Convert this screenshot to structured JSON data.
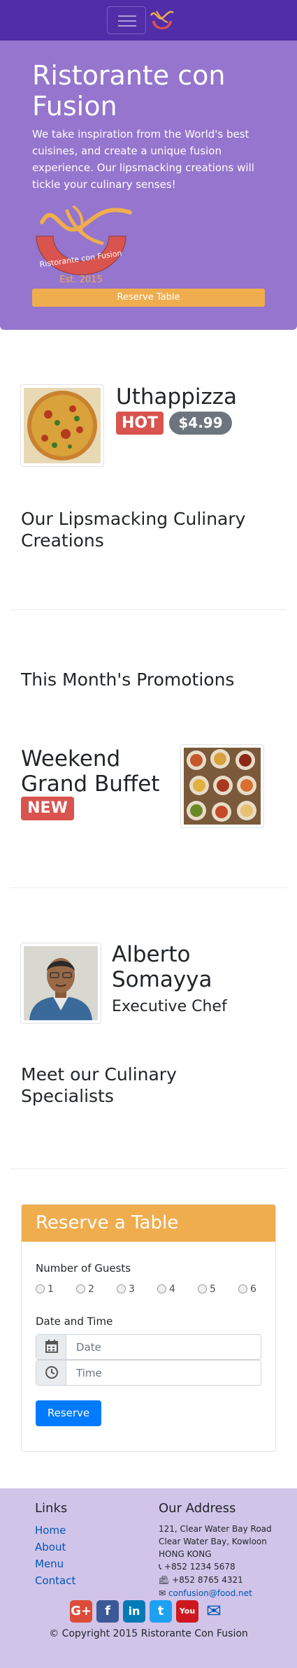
{
  "navbar": {
    "toggler_label": "Toggle navigation",
    "logo_icon": "restaurant-logo-icon"
  },
  "jumbotron": {
    "title": "Ristorante con Fusion",
    "description": "We take inspiration from the World's best cuisines, and create a unique fusion experience. Our lipsmacking creations will tickle your culinary senses!",
    "logo_text": "Ristorante con Fusion",
    "logo_est": "Est. 2015",
    "reserve_button": "Reserve Table"
  },
  "featured_dish": {
    "name": "Uthappizza",
    "label": "HOT",
    "price": "$4.99"
  },
  "section_dishes": "Our Lipsmacking Culinary Creations",
  "section_promotions": "This Month's Promotions",
  "promotion": {
    "name": "Weekend Grand Buffet",
    "label": "NEW"
  },
  "chef": {
    "name": "Alberto Somayya",
    "designation": "Executive Chef"
  },
  "section_leaders": "Meet our Culinary Specialists",
  "reservation": {
    "header": "Reserve a Table",
    "guests_label": "Number of Guests",
    "guest_options": [
      "1",
      "2",
      "3",
      "4",
      "5",
      "6"
    ],
    "datetime_label": "Date and Time",
    "date_placeholder": "Date",
    "time_placeholder": "Time",
    "submit_button": "Reserve"
  },
  "footer": {
    "links_title": "Links",
    "links": [
      "Home",
      "About",
      "Menu",
      "Contact"
    ],
    "address_title": "Our Address",
    "address_lines": [
      "121, Clear Water Bay Road",
      "Clear Water Bay, Kowloon",
      "HONG KONG"
    ],
    "phone": "+852 1234 5678",
    "fax": "+852 8765 4321",
    "email": "confusion@food.net",
    "social": [
      {
        "icon": "google-plus-icon",
        "text": "G+",
        "color": "#dd4b39"
      },
      {
        "icon": "facebook-icon",
        "text": "f",
        "color": "#3b5998"
      },
      {
        "icon": "linkedin-icon",
        "text": "in",
        "color": "#007bb6"
      },
      {
        "icon": "twitter-icon",
        "text": "t",
        "color": "#1da1f2"
      },
      {
        "icon": "youtube-icon",
        "text": "You",
        "color": "#cc181e"
      },
      {
        "icon": "mail-icon",
        "text": "✉",
        "color": "#0056b3"
      }
    ],
    "copyright": "© Copyright 2015 Ristorante Con Fusion"
  },
  "colors": {
    "primary_dark": "#512da8",
    "primary": "#9575cd",
    "primary_light": "#d1c4e9",
    "warning": "#f0ad4e",
    "danger": "#d9534f",
    "secondary": "#6c757d",
    "link": "#007bff"
  }
}
